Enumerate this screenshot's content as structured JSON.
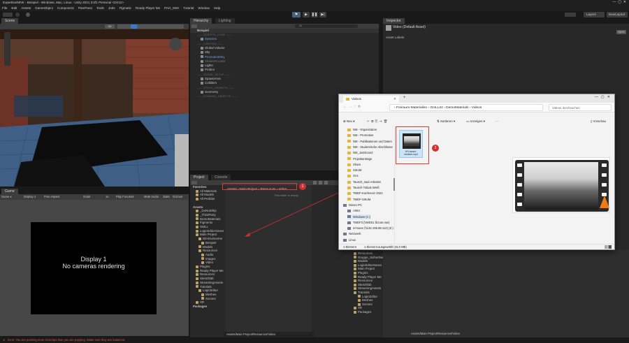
{
  "window_title": "Expertise/MNK - Beispiel - Windows, Mac, Linux - Unity 2021.3.5f1 Personal <DX11>",
  "menu": [
    "File",
    "Edit",
    "Assets",
    "GameObject",
    "Component",
    "FlexiPano",
    "Tools",
    "Jobs",
    "Figmatic",
    "Ready Player Me",
    "PAH_SDK",
    "Tutorial",
    "Window",
    "Help"
  ],
  "toolbar": {
    "layers": "Layers",
    "layout": "NewLayout"
  },
  "scene": {
    "tab": "Scene",
    "mode": "2D"
  },
  "hierarchy": {
    "tab": "Hierarchy",
    "tab2": "Lighting",
    "search_placeholder": "All",
    "root": "Beispiel",
    "items": [
      {
        "label": "------ SCRIPTS_CORE ------",
        "style": "sep",
        "indent": 2
      },
      {
        "label": "Systems",
        "style": "blue",
        "indent": 3
      },
      {
        "label": "------ LIGHTING ------",
        "style": "sep",
        "indent": 2
      },
      {
        "label": "Global Volume",
        "style": "",
        "indent": 3
      },
      {
        "label": "Sky",
        "style": "",
        "indent": 3
      },
      {
        "label": "ProceduralSky",
        "style": "blue",
        "indent": 3
      },
      {
        "label": "ShadowCookie",
        "style": "dim",
        "indent": 3
      },
      {
        "label": "Lights",
        "style": "",
        "indent": 3
      },
      {
        "label": "Probes",
        "style": "",
        "indent": 3
      },
      {
        "label": "------ SCENE_SETUP ------",
        "style": "sep",
        "indent": 2
      },
      {
        "label": "SpawnArea",
        "style": "",
        "indent": 3
      },
      {
        "label": "Colliders",
        "style": "",
        "indent": 3
      },
      {
        "label": "------ STATIC_OBJECTS ------",
        "style": "sep",
        "indent": 2
      },
      {
        "label": "Geometry",
        "style": "",
        "indent": 3
      },
      {
        "label": "------ DYNAMIC_OBJECTS ------",
        "style": "sep",
        "indent": 2
      }
    ]
  },
  "inspector": {
    "tab": "Inspector",
    "title": "Video (Default Asset)",
    "sub": "Asset Labels",
    "open": "Open"
  },
  "game": {
    "tab": "Game",
    "display": "Display 1",
    "aspect": "Free Aspect",
    "scale_label": "Scale",
    "scale_value": "1x",
    "play": "Play Focused",
    "mute": "Mute Audio",
    "stats": "Stats",
    "gizmos": "Gizmos",
    "msg1": "Display 1",
    "msg2": "No cameras rendering"
  },
  "project": {
    "tab": "Project",
    "tab2": "Console",
    "breadcrumb": [
      "Assets",
      "Main Project",
      "Resources",
      "Video"
    ],
    "empty": "This folder is empty",
    "footer": "Assets/Main Project/Resources/Video",
    "badge1": "1",
    "tree": [
      {
        "label": "Favorites",
        "indent": 0,
        "bold": true
      },
      {
        "label": "All Materials",
        "indent": 1
      },
      {
        "label": "All Models",
        "indent": 1
      },
      {
        "label": "All Prefabs",
        "indent": 1
      },
      {
        "label": "",
        "indent": 0
      },
      {
        "label": "Assets",
        "indent": 0,
        "bold": true
      },
      {
        "label": "_DoNotShip",
        "indent": 1
      },
      {
        "label": "_ThirdParty",
        "indent": 1
      },
      {
        "label": "DemoMaterials",
        "indent": 1
      },
      {
        "label": "Figments",
        "indent": 1
      },
      {
        "label": "GMLL",
        "indent": 1
      },
      {
        "label": "LogicEditorSaves",
        "indent": 1
      },
      {
        "label": "Main Project",
        "indent": 1
      },
      {
        "label": "3D-Environme",
        "indent": 2
      },
      {
        "label": "Beispiel",
        "indent": 3
      },
      {
        "label": "Models",
        "indent": 2
      },
      {
        "label": "Resources",
        "indent": 2
      },
      {
        "label": "Audio",
        "indent": 3
      },
      {
        "label": "Images",
        "indent": 3
      },
      {
        "label": "Video",
        "indent": 3
      },
      {
        "label": "Plugins",
        "indent": 1
      },
      {
        "label": "Ready Player Me",
        "indent": 1
      },
      {
        "label": "Resources",
        "indent": 1
      },
      {
        "label": "Sketchfab",
        "indent": 1
      },
      {
        "label": "StreamingAssets",
        "indent": 1
      },
      {
        "label": "Tutorials",
        "indent": 1
      },
      {
        "label": "LogicEditor",
        "indent": 2
      },
      {
        "label": "Meshes",
        "indent": 3
      },
      {
        "label": "Scenes",
        "indent": 3
      },
      {
        "label": "XR",
        "indent": 1
      },
      {
        "label": "Packages",
        "indent": 0,
        "bold": true
      }
    ]
  },
  "project2_tree": [
    "Resources",
    "Gruppe_Sichenheit",
    "Models",
    "LogicEditorSaves",
    "Main Project",
    "Plugins",
    "Ready Player Me",
    "Resources",
    "Sketchfab",
    "StreamingAssets",
    "Tutorials",
    "LogicEditor",
    "Meshes",
    "Scenes",
    "XR",
    "Packages"
  ],
  "explorer": {
    "tab_title": "Videos",
    "path": [
      "Freiraum-Materialien",
      "GmLL24",
      "DemoMaterials",
      "Videos"
    ],
    "search_placeholder": "Videos durchsuchen",
    "new_btn": "Neu",
    "sort_btn": "Sortieren",
    "view_btn": "Anzeigen",
    "preview_btn": "Vorschau",
    "nav": [
      {
        "label": "NM - Organization",
        "kind": "folder"
      },
      {
        "label": "NM - Promotion",
        "kind": "folder"
      },
      {
        "label": "NM - Publikationen und Daten",
        "kind": "folder"
      },
      {
        "label": "NM - Studentische Abschlüsse",
        "kind": "folder"
      },
      {
        "label": "NM_JustScan3",
        "kind": "folder"
      },
      {
        "label": "Projektanträge",
        "kind": "folder"
      },
      {
        "label": "Share",
        "kind": "folder"
      },
      {
        "label": "SiKoM",
        "kind": "folder"
      },
      {
        "label": "SVL",
        "kind": "folder"
      },
      {
        "label": "Tausch_stud.Arbeiten",
        "kind": "folder"
      },
      {
        "label": "Tausch-Tobias Weiß",
        "kind": "folder"
      },
      {
        "label": "TMDF-Konferenz 2024",
        "kind": "folder"
      },
      {
        "label": "TMDF-SiKoM",
        "kind": "folder"
      },
      {
        "label": "Dieser PC",
        "kind": "pc"
      },
      {
        "label": "A063",
        "kind": "drive"
      },
      {
        "label": "Windows (C:)",
        "kind": "drive"
      },
      {
        "label": "TMDF3 (\\\\WD01.fd.tum.mw)",
        "kind": "drive"
      },
      {
        "label": "nrl-save (\\\\132.195.88.112) (Z:)",
        "kind": "drive"
      },
      {
        "label": "Netzwerk",
        "kind": "pc"
      },
      {
        "label": "Linux",
        "kind": "pc"
      }
    ],
    "file_name": "AYLaunch-medium.mp4",
    "badge2": "2",
    "status_left": "1 Element",
    "status_mid": "1 Element ausgewählt (15,0 MB)"
  },
  "status_bar": {
    "error": "Error: You are pushing more GUIClips than you are popping. Make sure they are balanced."
  },
  "colors": {
    "unity_bg": "#191919",
    "panel": "#282828",
    "accent": "#3a79c4",
    "callout": "#d32f2f",
    "explorer_bg": "#f3f3f3"
  }
}
